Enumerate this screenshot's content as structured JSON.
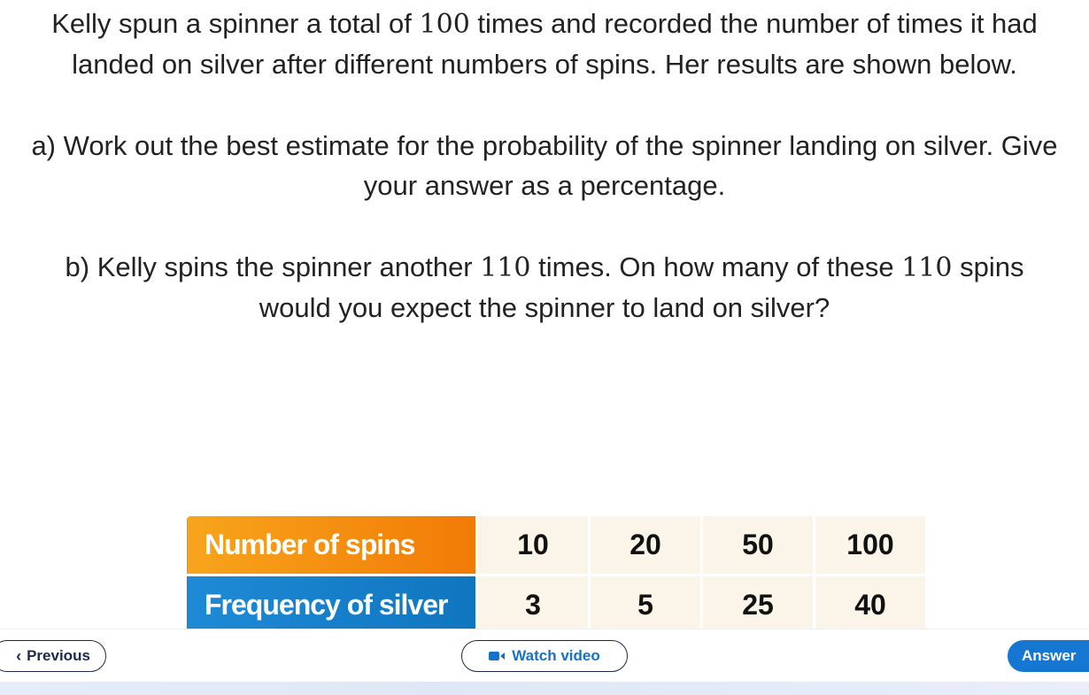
{
  "question": {
    "intro": [
      "Kelly spun a spinner a total of ",
      "100",
      " times and recorded the number of times it had landed on silver after different numbers of spins. Her results are shown below."
    ],
    "part_a": "a) Work out the best estimate for the probability of the spinner landing on silver. Give your answer as a percentage.",
    "part_b": [
      "b) Kelly spins the spinner another ",
      "110",
      " times. On how many of these ",
      "110",
      " spins would you expect the spinner to land on silver?"
    ]
  },
  "table": {
    "row1": {
      "header": "Number of spins",
      "values": [
        "10",
        "20",
        "50",
        "100"
      ]
    },
    "row2": {
      "header": "Frequency of silver",
      "values": [
        "3",
        "5",
        "25",
        "40"
      ]
    }
  },
  "footer": {
    "previous_label": "Previous",
    "watch_video_label": "Watch video",
    "answer_label": "Answer"
  },
  "icons": {
    "previous": "chevron-left-icon",
    "video": "video-camera-icon"
  },
  "colors": {
    "header_orange": "#f27a06",
    "header_blue": "#1075bf",
    "cell_bg": "#fbf4e8",
    "accent_blue": "#1677d2"
  }
}
